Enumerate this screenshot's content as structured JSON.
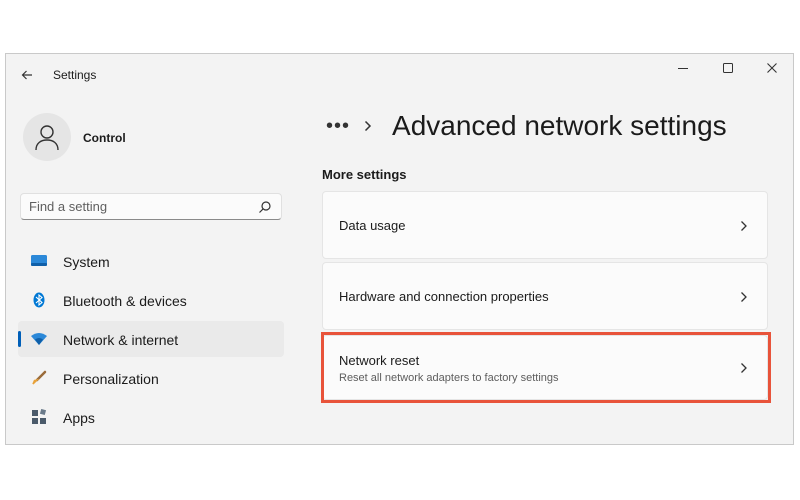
{
  "window": {
    "title": "Settings"
  },
  "profile": {
    "name": "Control"
  },
  "search": {
    "placeholder": "Find a setting"
  },
  "sidebar": {
    "items": [
      {
        "label": "System",
        "icon": "system-icon"
      },
      {
        "label": "Bluetooth & devices",
        "icon": "bluetooth-icon"
      },
      {
        "label": "Network & internet",
        "icon": "wifi-icon",
        "selected": true
      },
      {
        "label": "Personalization",
        "icon": "brush-icon"
      },
      {
        "label": "Apps",
        "icon": "apps-icon"
      }
    ]
  },
  "breadcrumb": {
    "overflow": "•••",
    "title": "Advanced network settings"
  },
  "section": {
    "heading": "More settings"
  },
  "cards": [
    {
      "title": "Data usage"
    },
    {
      "title": "Hardware and connection properties"
    },
    {
      "title": "Network reset",
      "description": "Reset all network adapters to factory settings",
      "highlighted": true
    }
  ],
  "colors": {
    "accent": "#005fb8",
    "highlight_border": "#e8533a",
    "window_bg": "#f3f3f3",
    "card_bg": "#fbfbfb"
  }
}
